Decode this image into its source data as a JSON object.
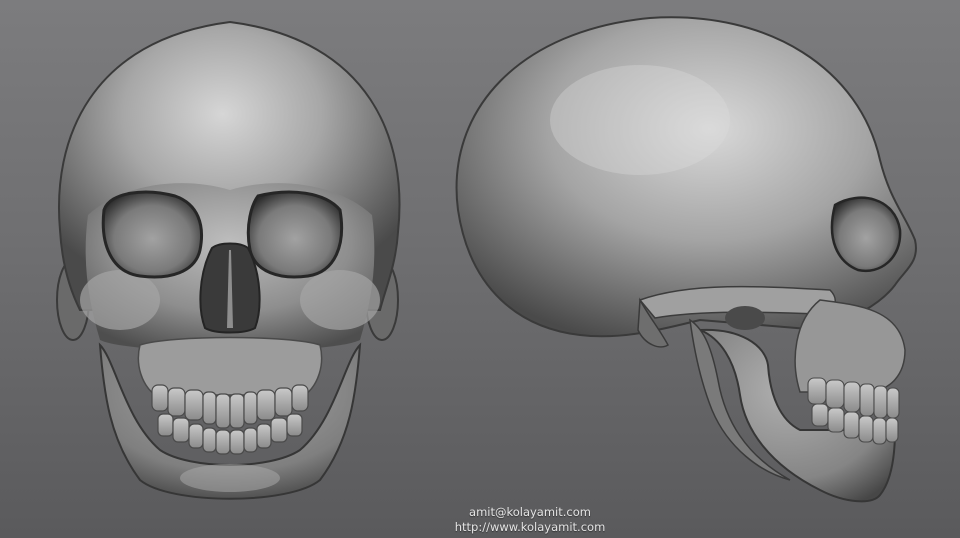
{
  "credits": {
    "email": "amit@kolayamit.com",
    "website": "http://www.kolayamit.com"
  },
  "subjects": {
    "left": "skull-front-view",
    "right": "skull-side-view"
  },
  "colors": {
    "background_top": "#7c7c7e",
    "background_bottom": "#5a5a5c",
    "bone": "#9a9a9a",
    "shadow": "#2a2a2a",
    "highlight": "#d8d8d8",
    "credit_text": "#e4e4e4"
  }
}
